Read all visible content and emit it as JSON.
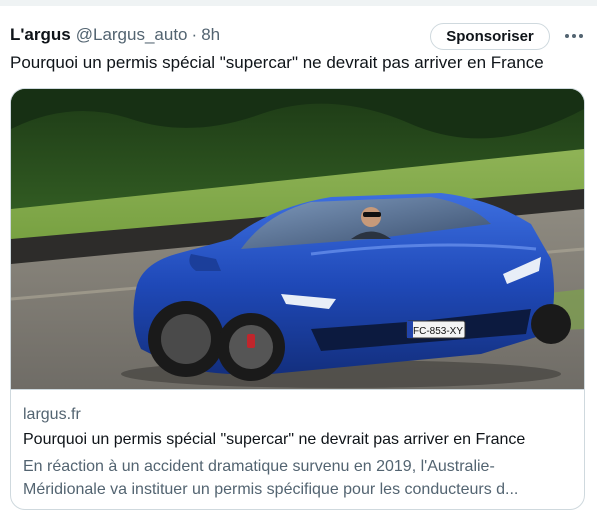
{
  "tweet": {
    "author_name": "L'argus",
    "author_handle": "@Largus_auto",
    "separator": "·",
    "timestamp": "8h",
    "sponsor_label": "Sponsoriser",
    "text": "Pourquoi un permis spécial \"supercar\" ne devrait pas arriver en France"
  },
  "card": {
    "domain": "largus.fr",
    "title": "Pourquoi un permis spécial \"supercar\" ne devrait pas arriver en France",
    "description_line1": "En réaction à un accident dramatique survenu en 2019, l'Australie-",
    "description_line2": "Méridionale va instituer un permis spécifique pour les conducteurs d...",
    "image": {
      "subject": "blue-convertible-supercar",
      "license_plate": "FC-853-XY"
    }
  },
  "icons": {
    "more": "more-horizontal-icon"
  },
  "colors": {
    "text_primary": "#0f1419",
    "text_secondary": "#536471",
    "border": "#cfd9de",
    "car_blue": "#1f49b8"
  }
}
